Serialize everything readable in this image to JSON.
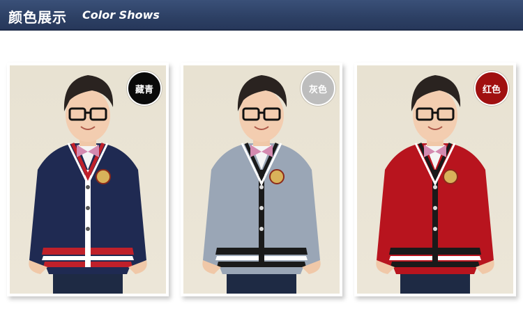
{
  "header": {
    "title_cn": "颜色展示",
    "title_en": "Color Shows"
  },
  "cards": [
    {
      "label": "藏青",
      "color": "#0a0a0a",
      "sweater": "#1f2a52",
      "stripe": "#c0202a"
    },
    {
      "label": "灰色",
      "color": "#bdbdbd",
      "sweater": "#9aa6b6",
      "stripe": "#1a1a1a"
    },
    {
      "label": "红色",
      "color": "#a01010",
      "sweater": "#b8141e",
      "stripe": "#1a1a1a"
    }
  ]
}
